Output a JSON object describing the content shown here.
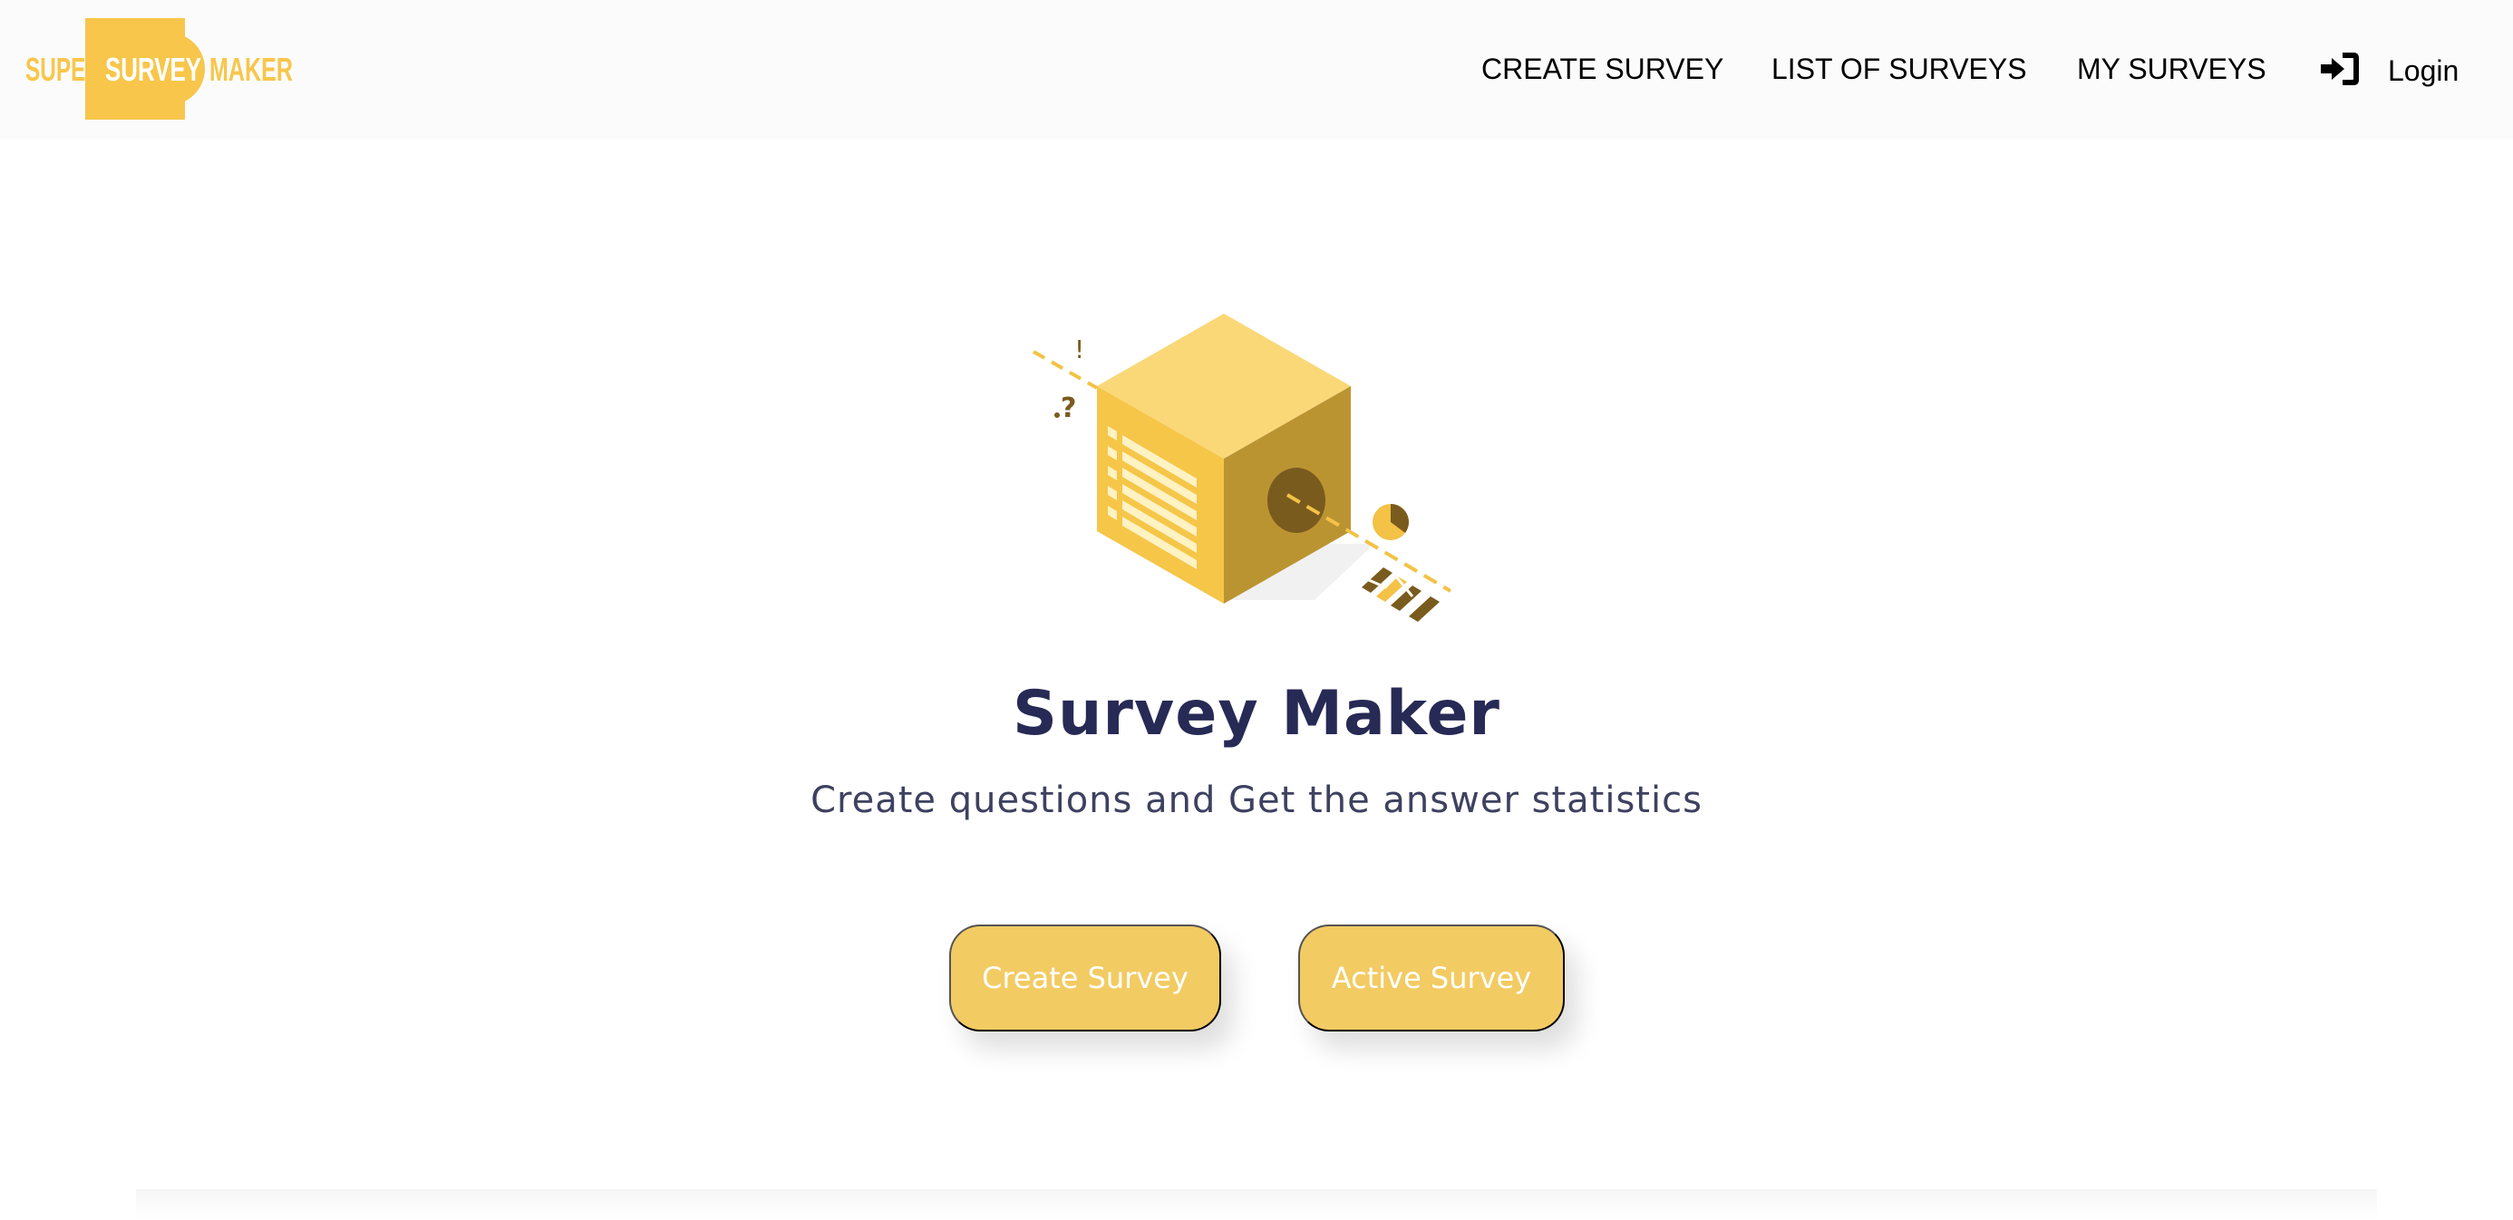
{
  "brand": {
    "logo_text": "SUPER SURVEY MAKER",
    "logo_word_1": "SUPER",
    "logo_word_2": "SURVEY",
    "logo_word_3": "MAKER",
    "color": "#f7c64b"
  },
  "nav": {
    "create_survey": "CREATE SURVEY",
    "list_of_surveys": "LIST OF SURVEYS",
    "my_surveys": "MY SURVEYS",
    "login_label": "Login",
    "login_icon": "sign-in-icon"
  },
  "hero": {
    "illustration": "isometric-survey-box-illustration",
    "title": "Survey Maker",
    "subtitle": "Create questions and Get the answer statistics",
    "title_color": "#272a55"
  },
  "actions": {
    "create_survey_label": "Create Survey",
    "active_survey_label": "Active Survey",
    "button_color": "#f3cb63"
  }
}
